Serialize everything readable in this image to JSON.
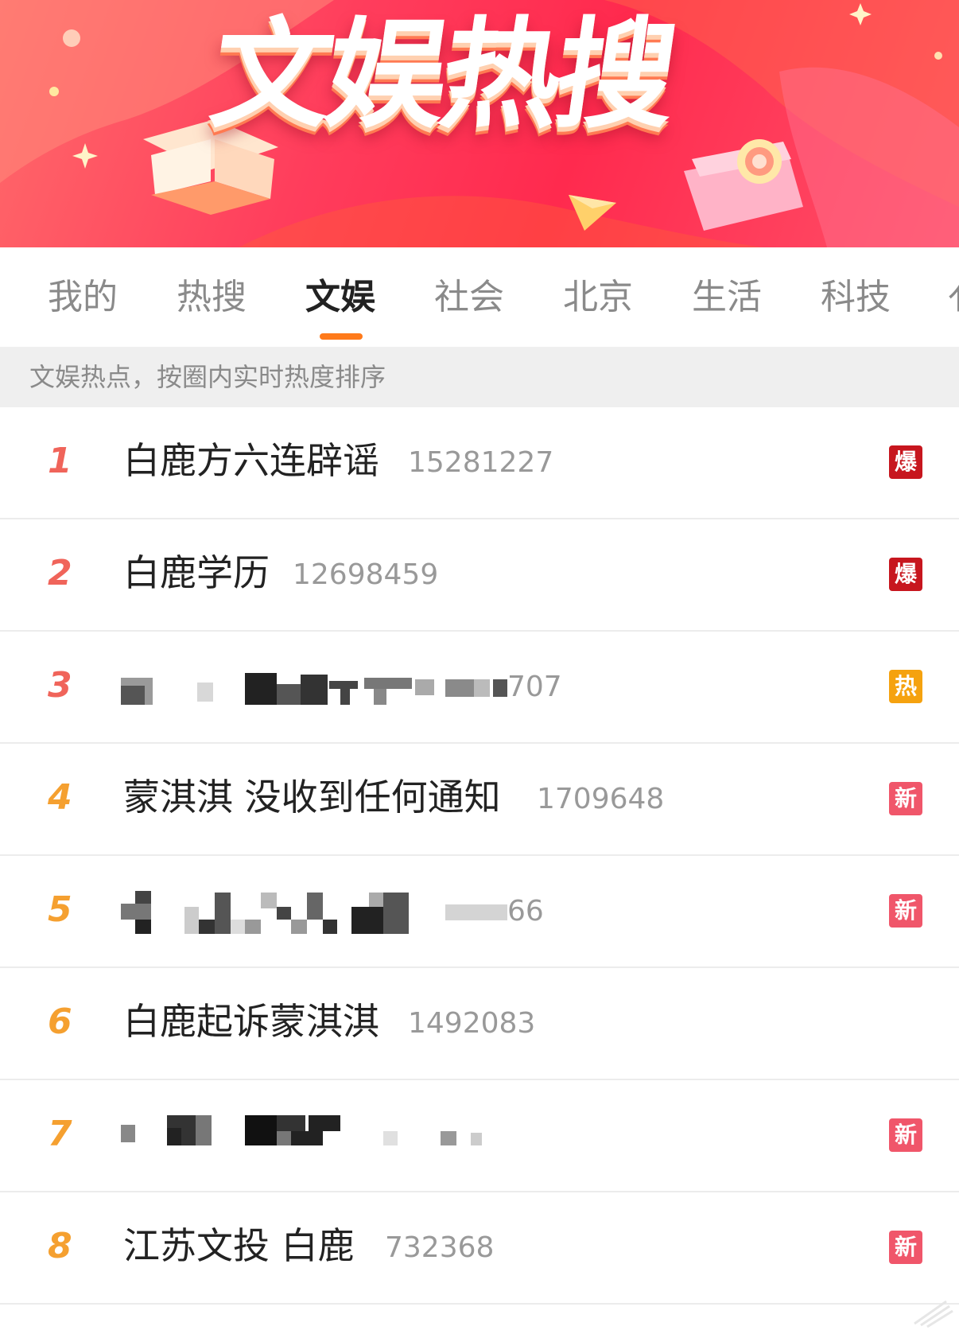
{
  "banner": {
    "title": "文娱热搜"
  },
  "tabs": [
    {
      "label": "我的",
      "active": false
    },
    {
      "label": "热搜",
      "active": false
    },
    {
      "label": "文娱",
      "active": true
    },
    {
      "label": "社会",
      "active": false
    },
    {
      "label": "北京",
      "active": false
    },
    {
      "label": "生活",
      "active": false
    },
    {
      "label": "科技",
      "active": false
    },
    {
      "label": "亻",
      "active": false
    }
  ],
  "notice": {
    "text": "文娱热点，按圈内实时热度排序"
  },
  "list": [
    {
      "rank": "1",
      "title": "白鹿方六连辟谣",
      "count": "15281227",
      "badge": "爆"
    },
    {
      "rank": "2",
      "title": "白鹿学历",
      "count": "12698459",
      "badge": "爆"
    },
    {
      "rank": "3",
      "title": "",
      "count": "707",
      "badge": "热",
      "blurred": true
    },
    {
      "rank": "4",
      "title": "蒙淇淇 没收到任何通知",
      "count": "1709648",
      "badge": "新"
    },
    {
      "rank": "5",
      "title": "",
      "count": "66",
      "badge": "新",
      "blurred": true
    },
    {
      "rank": "6",
      "title": "白鹿起诉蒙淇淇",
      "count": "1492083",
      "badge": ""
    },
    {
      "rank": "7",
      "title": "",
      "count": "",
      "badge": "新",
      "blurred": true
    },
    {
      "rank": "8",
      "title": "江苏文投 白鹿",
      "count": "732368",
      "badge": "新"
    }
  ],
  "colors": {
    "banner_red": "#ff2a4e",
    "tab_indicator": "#ff7a1a",
    "rank_top": "#f0645a",
    "rank_other": "#f5a030",
    "badge_bao": "#c7161e",
    "badge_re": "#f5a20f",
    "badge_xin": "#f0566a"
  }
}
